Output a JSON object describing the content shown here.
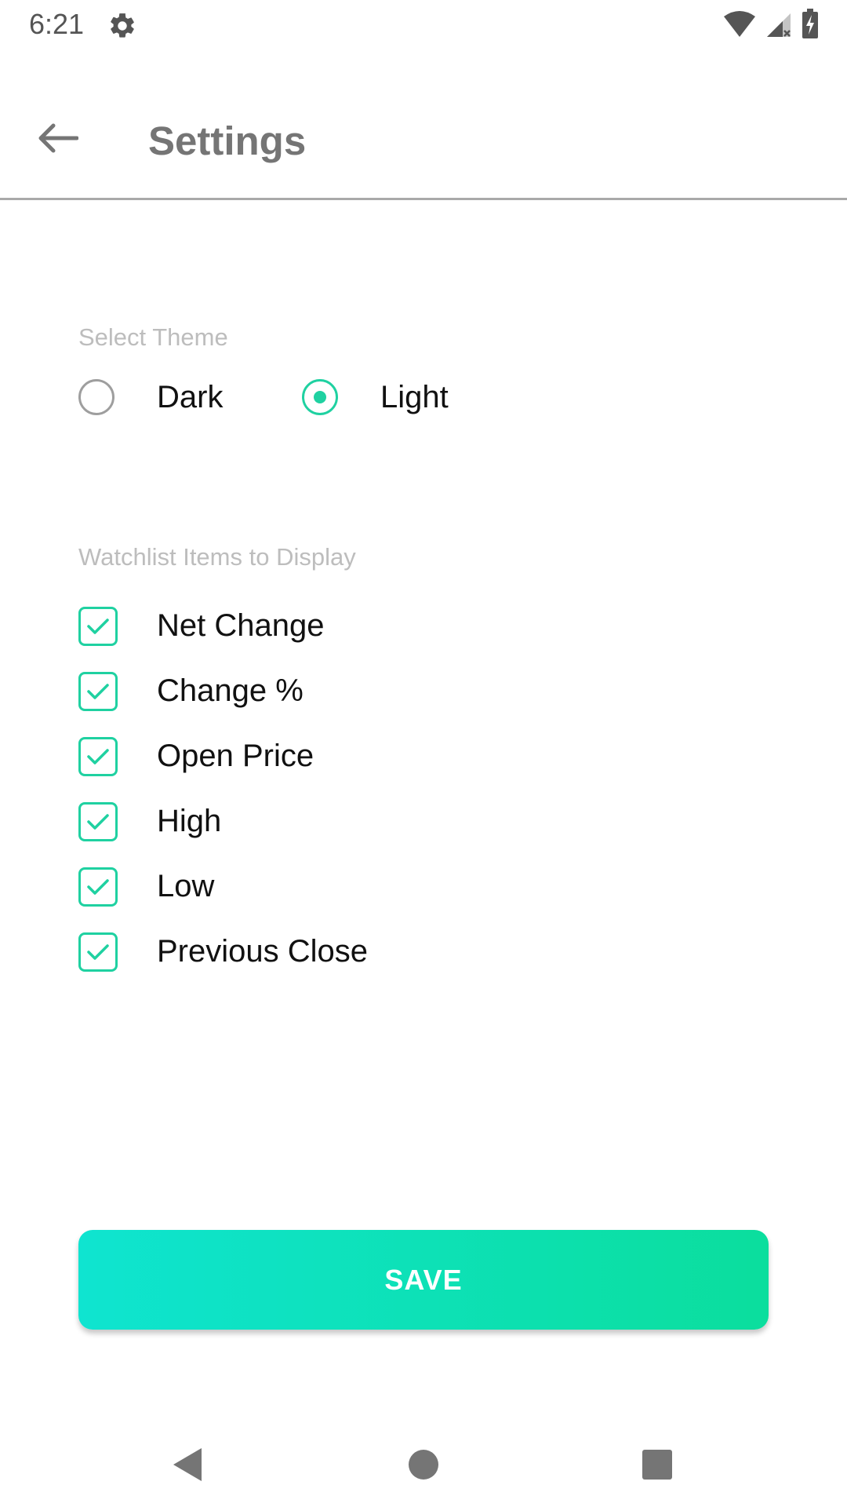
{
  "status_bar": {
    "time": "6:21",
    "icons": [
      "settings-gear-icon",
      "wifi-icon",
      "cell-signal-icon",
      "battery-charging-icon"
    ]
  },
  "app_bar": {
    "back_icon": "arrow-left-icon",
    "title": "Settings"
  },
  "theme_section": {
    "label": "Select Theme",
    "options": [
      {
        "label": "Dark",
        "selected": false
      },
      {
        "label": "Light",
        "selected": true
      }
    ]
  },
  "watchlist_section": {
    "label": "Watchlist Items to Display",
    "items": [
      {
        "label": "Net Change",
        "checked": true
      },
      {
        "label": "Change %",
        "checked": true
      },
      {
        "label": "Open Price",
        "checked": true
      },
      {
        "label": "High",
        "checked": true
      },
      {
        "label": "Low",
        "checked": true
      },
      {
        "label": "Previous Close",
        "checked": true
      }
    ]
  },
  "save_button": {
    "label": "SAVE"
  },
  "nav_bar": {
    "icons": [
      "nav-back-icon",
      "nav-home-icon",
      "nav-recents-icon"
    ]
  },
  "colors": {
    "accent": "#1fd1a1",
    "button_gradient_start": "#0fe4d0",
    "button_gradient_end": "#0bde9d",
    "section_label": "#bdbdbd",
    "title": "#757575"
  }
}
